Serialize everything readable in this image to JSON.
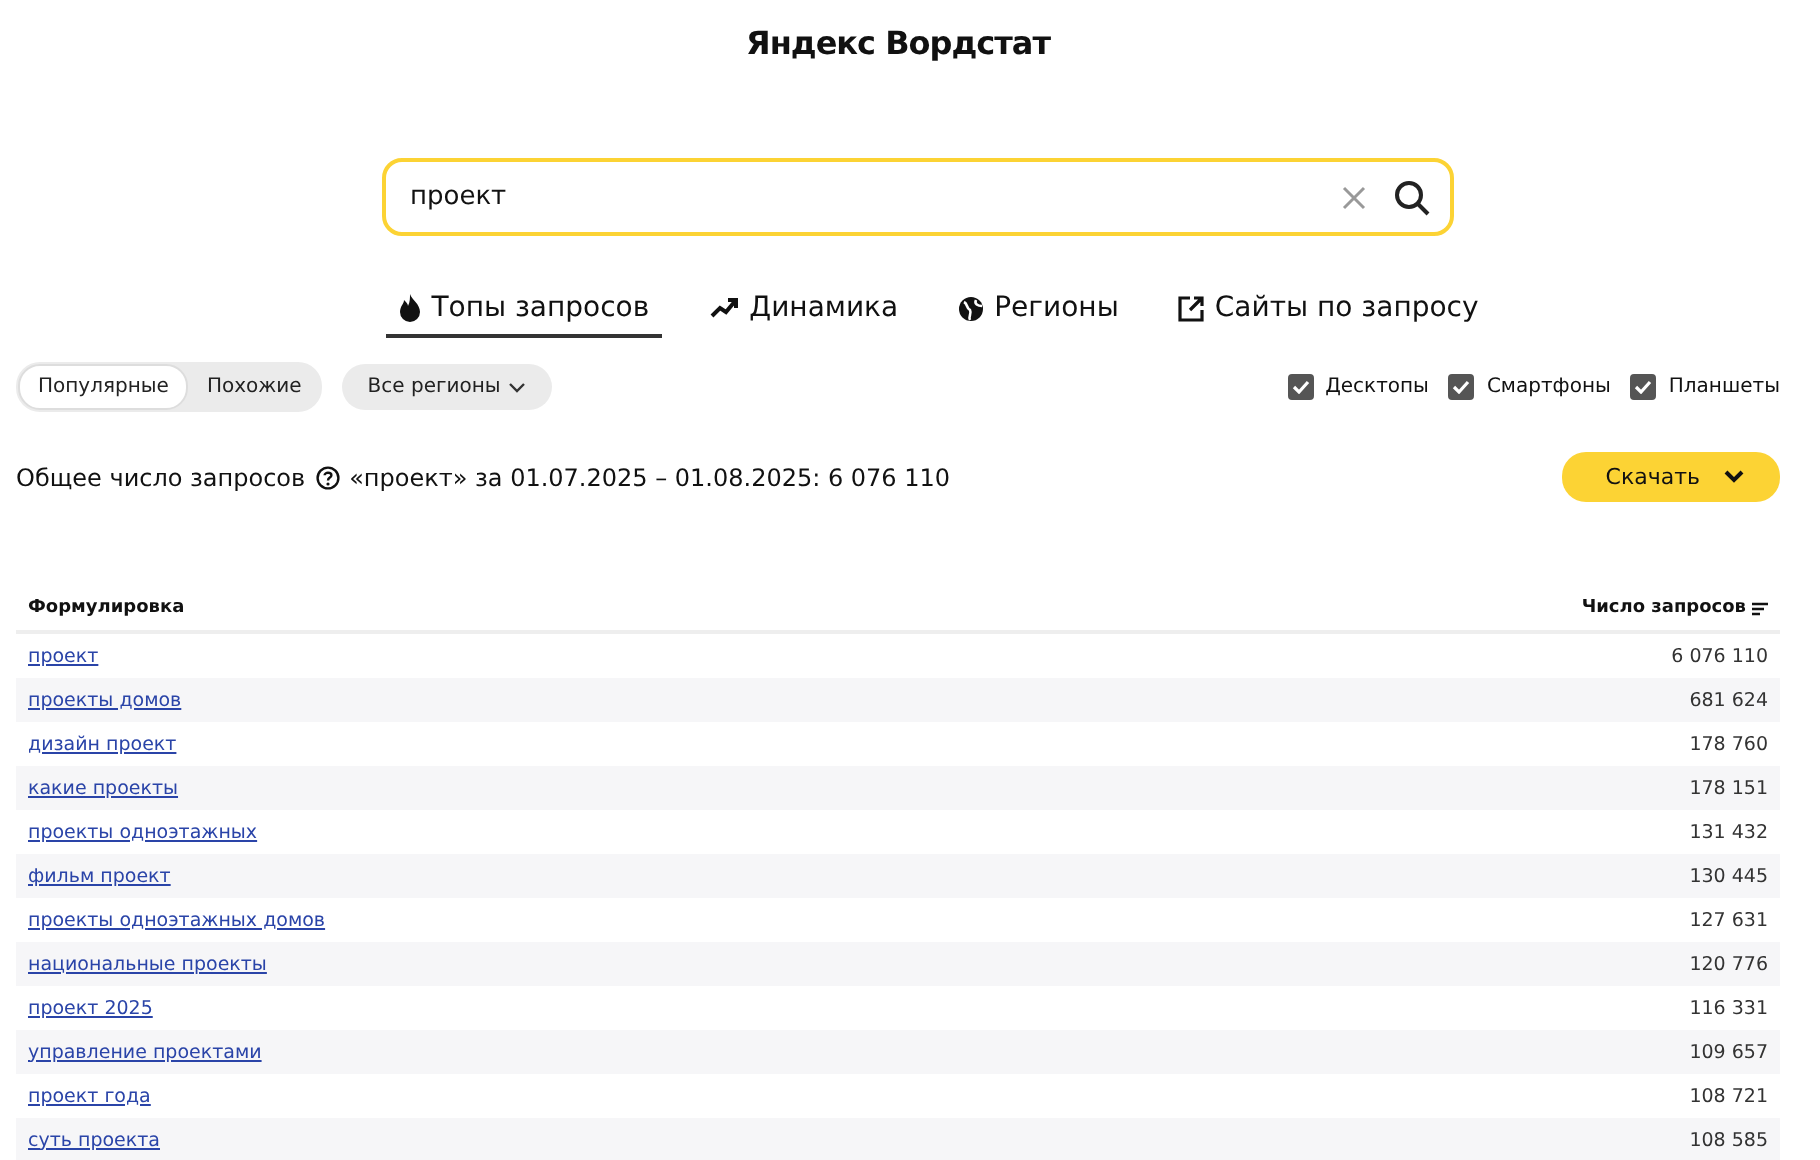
{
  "header": {
    "title": "Яндекс Вордстат"
  },
  "search": {
    "value": "проект"
  },
  "tabs": [
    {
      "label": "Топы запросов",
      "selected": true
    },
    {
      "label": "Динамика",
      "selected": false
    },
    {
      "label": "Регионы",
      "selected": false
    },
    {
      "label": "Сайты по запросу",
      "selected": false
    }
  ],
  "modes": [
    {
      "label": "Популярные",
      "selected": true
    },
    {
      "label": "Похожие",
      "selected": false
    }
  ],
  "region_button": "Все регионы",
  "devices": [
    {
      "label": "Десктопы",
      "checked": true
    },
    {
      "label": "Смартфоны",
      "checked": true
    },
    {
      "label": "Планшеты",
      "checked": true
    }
  ],
  "summary": {
    "label": "Общее число запросов",
    "text": "«проект» за 01.07.2025 – 01.08.2025: 6 076 110"
  },
  "download_button": "Скачать",
  "table": {
    "columns": [
      "Формулировка",
      "Число запросов"
    ],
    "rows": [
      {
        "phrase": "проект",
        "count": "6 076 110"
      },
      {
        "phrase": "проекты домов",
        "count": "681 624"
      },
      {
        "phrase": "дизайн проект",
        "count": "178 760"
      },
      {
        "phrase": "какие проекты",
        "count": "178 151"
      },
      {
        "phrase": "проекты одноэтажных",
        "count": "131 432"
      },
      {
        "phrase": "фильм проект",
        "count": "130 445"
      },
      {
        "phrase": "проекты одноэтажных домов",
        "count": "127 631"
      },
      {
        "phrase": "национальные проекты",
        "count": "120 776"
      },
      {
        "phrase": "проект 2025",
        "count": "116 331"
      },
      {
        "phrase": "управление проектами",
        "count": "109 657"
      },
      {
        "phrase": "проект года",
        "count": "108 721"
      },
      {
        "phrase": "суть проекта",
        "count": "108 585"
      }
    ]
  }
}
